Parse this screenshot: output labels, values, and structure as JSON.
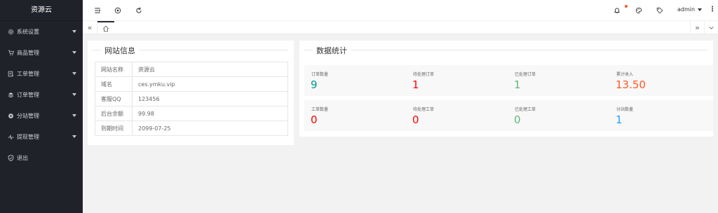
{
  "sidebar": {
    "brand": "资源云",
    "items": [
      {
        "label": "系统设置",
        "icon": "gear-icon"
      },
      {
        "label": "商品管理",
        "icon": "cart-icon"
      },
      {
        "label": "工单管理",
        "icon": "ticket-icon"
      },
      {
        "label": "订单管理",
        "icon": "layers-icon"
      },
      {
        "label": "分站管理",
        "icon": "globe-icon"
      },
      {
        "label": "提现管理",
        "icon": "pulse-icon"
      },
      {
        "label": "退出",
        "icon": "shield-icon"
      }
    ]
  },
  "header": {
    "user": "admin",
    "icons": [
      "menu-fold-icon",
      "globe-icon",
      "refresh-icon",
      "bell-icon",
      "theme-icon",
      "tag-icon",
      "more-icon"
    ],
    "notification_dot_color": "#ff5722"
  },
  "tabs": {
    "home_icon": "home-icon"
  },
  "site_info": {
    "title": "网站信息",
    "rows": [
      {
        "key": "网站名称",
        "value": "资源云"
      },
      {
        "key": "域名",
        "value": "ces.ymku.vip"
      },
      {
        "key": "客服QQ",
        "value": "123456"
      },
      {
        "key": "后台余额",
        "value": "99.98"
      },
      {
        "key": "到期时间",
        "value": "2099-07-25"
      }
    ]
  },
  "stats": {
    "title": "数据统计",
    "cards": [
      {
        "label": "订单数量",
        "value": "9",
        "color": "#009688"
      },
      {
        "label": "待处理订单",
        "value": "1",
        "color": "#ff0000"
      },
      {
        "label": "已处理订单",
        "value": "1",
        "color": "#5fb878"
      },
      {
        "label": "累计收入",
        "value": "13.50",
        "color": "#ff5722"
      },
      {
        "label": "工单数量",
        "value": "0",
        "color": "#ff0000"
      },
      {
        "label": "待处理工单",
        "value": "0",
        "color": "#ff0000"
      },
      {
        "label": "已处理工单",
        "value": "0",
        "color": "#5fb878"
      },
      {
        "label": "分站数量",
        "value": "1",
        "color": "#1e9fff"
      }
    ]
  },
  "colors": {
    "sidebar_bg": "#20222a",
    "page_bg": "#f2f2f2"
  }
}
